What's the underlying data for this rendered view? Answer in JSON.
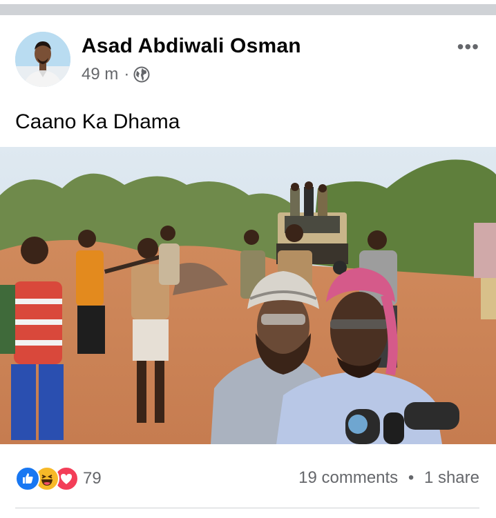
{
  "post": {
    "author_name": "Asad Abdiwali Osman",
    "time": "49 m",
    "separator": "·",
    "privacy_icon": "globe-icon",
    "more_icon": "more-options-icon",
    "more_label": "•••",
    "caption": "Caano Ka Dhama"
  },
  "reactions": {
    "icons": [
      "like-icon",
      "haha-icon",
      "love-icon"
    ],
    "count": "79"
  },
  "engagement": {
    "comments": "19 comments",
    "bullet": "•",
    "shares": "1 share"
  },
  "colors": {
    "like": "#1877f2",
    "love": "#f33e58",
    "haha": "#f7b928",
    "secondary_text": "#65676b",
    "top_bar": "#cfd2d6"
  }
}
